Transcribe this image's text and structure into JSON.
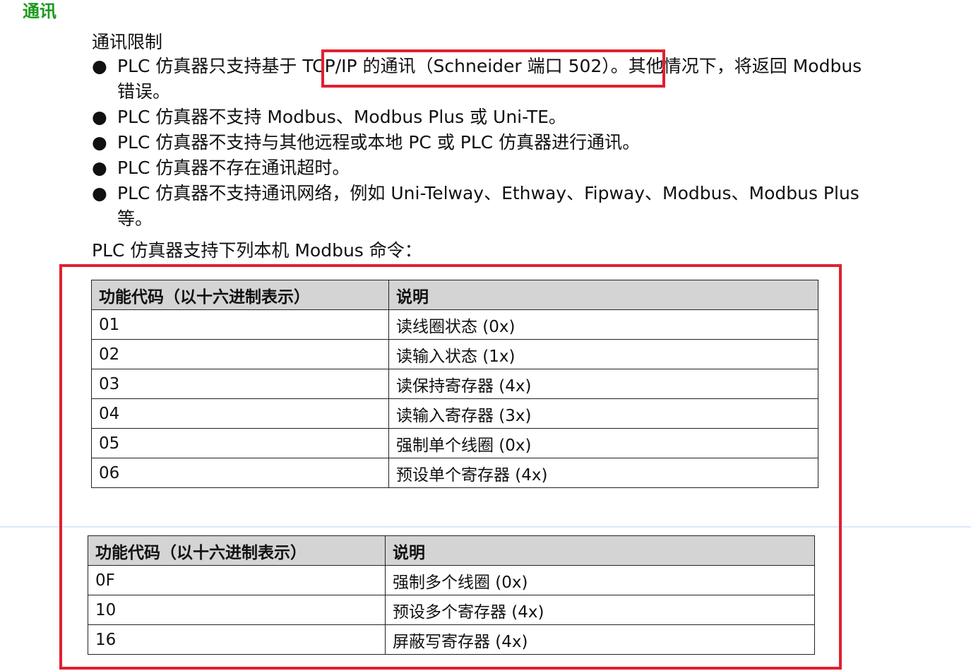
{
  "section_title": "通讯",
  "limits": {
    "heading": "通讯限制",
    "bullet_symbol": "●",
    "items": [
      {
        "text": "PLC 仿真器只支持基于 TCP/IP 的通讯（Schneider 端口 502）。其他情况下，将返回 Modbus",
        "cont": "错误。"
      },
      {
        "text": "PLC 仿真器不支持 Modbus、Modbus Plus 或 Uni-TE。"
      },
      {
        "text": "PLC 仿真器不支持与其他远程或本地 PC 或 PLC 仿真器进行通讯。"
      },
      {
        "text": "PLC 仿真器不存在通讯超时。"
      },
      {
        "text": "PLC 仿真器不支持通讯网络，例如 Uni-Telway、Ethway、Fipway、Modbus、Modbus Plus",
        "cont": "等。"
      }
    ]
  },
  "commands_intro": "PLC 仿真器支持下列本机 Modbus 命令：",
  "table1": {
    "headers": [
      "功能代码（以十六进制表示）",
      "说明"
    ],
    "rows": [
      [
        "01",
        "读线圈状态 (0x)"
      ],
      [
        "02",
        "读输入状态 (1x)"
      ],
      [
        "03",
        "读保持寄存器 (4x)"
      ],
      [
        "04",
        "读输入寄存器 (3x)"
      ],
      [
        "05",
        "强制单个线圈 (0x)"
      ],
      [
        "06",
        "预设单个寄存器 (4x)"
      ]
    ]
  },
  "table2": {
    "headers": [
      "功能代码（以十六进制表示）",
      "说明"
    ],
    "rows": [
      [
        "0F",
        "强制多个线圈 (0x)"
      ],
      [
        "10",
        "预设多个寄存器 (4x)"
      ],
      [
        "16",
        "屏蔽写寄存器 (4x)"
      ]
    ]
  },
  "colors": {
    "title_green": "#1c9a1c",
    "highlight_red": "#e02030",
    "header_gray": "#d4d4d4"
  }
}
